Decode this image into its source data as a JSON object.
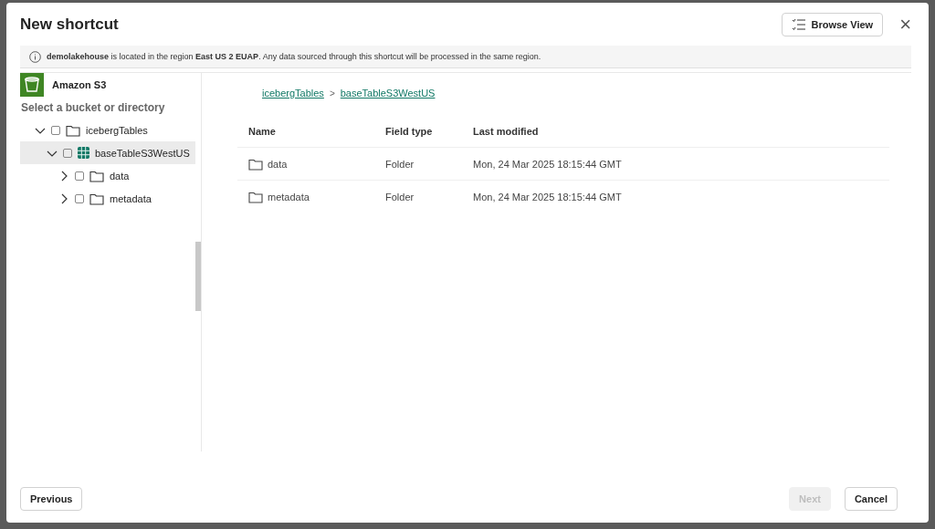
{
  "dialog": {
    "title": "New shortcut",
    "browse_view_button": "Browse View",
    "close_button": "×"
  },
  "info_bar": {
    "text": "**demolakehouse** is located in the region **East US 2 EUAP**. Any data sourced through this shortcut will be processed in the same region."
  },
  "source": {
    "name": "Amazon S3"
  },
  "tree": {
    "heading": "Select a bucket or directory",
    "items": [
      {
        "label": "icebergTables",
        "kind": "folder",
        "expanded": true,
        "checked": false,
        "selected": false,
        "children": [
          {
            "label": "baseTableS3WestUS",
            "kind": "table",
            "expanded": true,
            "checked": false,
            "selected": true,
            "children": [
              {
                "label": "data",
                "kind": "folder",
                "expanded": false,
                "checked": false,
                "selected": false
              },
              {
                "label": "metadata",
                "kind": "folder",
                "expanded": false,
                "checked": false,
                "selected": false
              }
            ]
          }
        ]
      }
    ]
  },
  "breadcrumb": [
    "icebergTables",
    "baseTableS3WestUS"
  ],
  "breadcrumb_separator": ">",
  "table": {
    "columns": [
      "Name",
      "Field type",
      "Last modified"
    ],
    "rows": [
      {
        "name": "data",
        "field_type": "Folder",
        "last_modified": "Mon, 24 Mar 2025 18:15:44 GMT"
      },
      {
        "name": "metadata",
        "field_type": "Folder",
        "last_modified": "Mon, 24 Mar 2025 18:15:44 GMT"
      }
    ]
  },
  "footer": {
    "previous": {
      "label": "Previous",
      "disabled": false
    },
    "next": {
      "label": "Next",
      "disabled": true
    },
    "cancel": {
      "label": "Cancel",
      "disabled": false
    }
  }
}
